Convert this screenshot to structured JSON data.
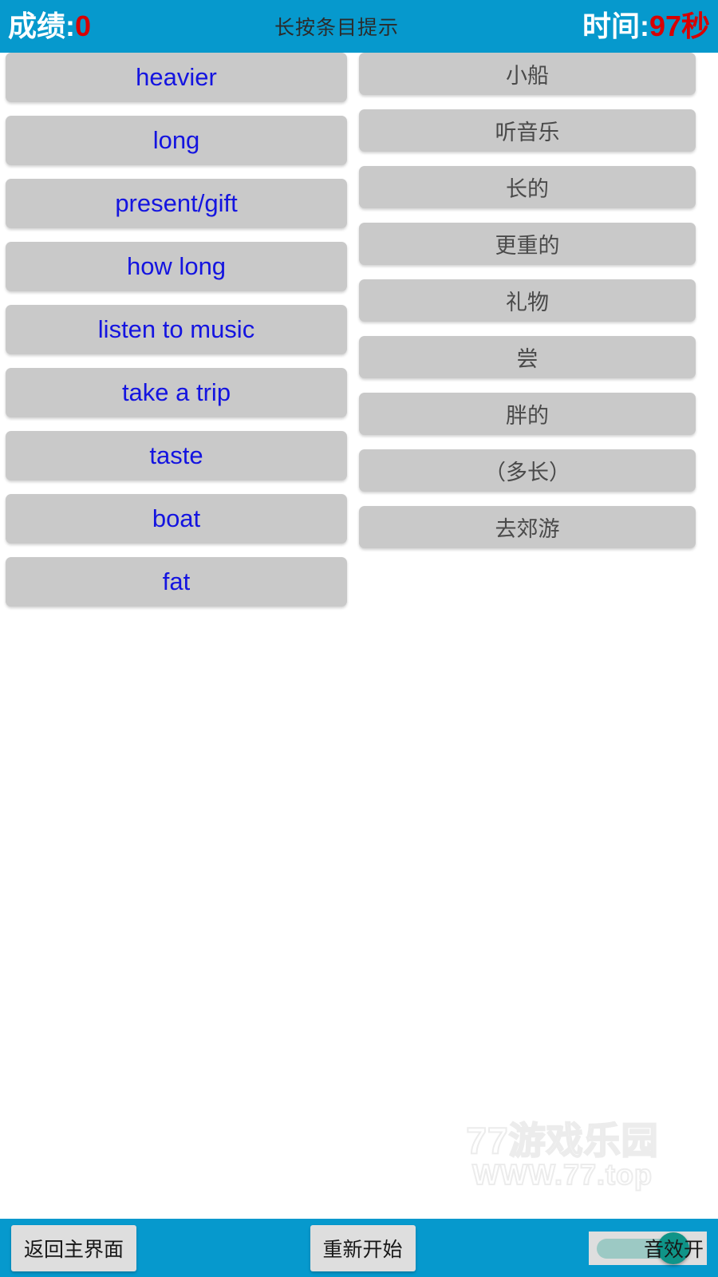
{
  "header": {
    "score_label": "成绩:",
    "score_value": "0",
    "hint": "长按条目提示",
    "time_label": "时间:",
    "time_value": "97秒",
    "bar_color": "#0699cd",
    "label_color": "#ffffff",
    "value_color": "#d80000"
  },
  "game": {
    "left_column": [
      {
        "label": "heavier"
      },
      {
        "label": "long"
      },
      {
        "label": "present/gift"
      },
      {
        "label": "how long"
      },
      {
        "label": "listen to music"
      },
      {
        "label": "take a trip"
      },
      {
        "label": "taste"
      },
      {
        "label": "boat"
      },
      {
        "label": "fat"
      }
    ],
    "right_column": [
      {
        "label": "小船"
      },
      {
        "label": "听音乐"
      },
      {
        "label": "长的"
      },
      {
        "label": "更重的"
      },
      {
        "label": "礼物"
      },
      {
        "label": "尝"
      },
      {
        "label": "胖的"
      },
      {
        "label": "（多长）"
      },
      {
        "label": "去郊游"
      }
    ],
    "card_color": "#c9c9c9",
    "left_text_color": "#1414e0",
    "right_text_color": "#4a4a4a"
  },
  "watermark": {
    "main": "77游戏乐园",
    "sub": "WWW.77.top"
  },
  "footer": {
    "home_label": "返回主界面",
    "restart_label": "重新开始",
    "sound_label": "音效开",
    "sound_on": true,
    "thumb_color": "#0f9488",
    "track_color": "#9cc9c4"
  }
}
